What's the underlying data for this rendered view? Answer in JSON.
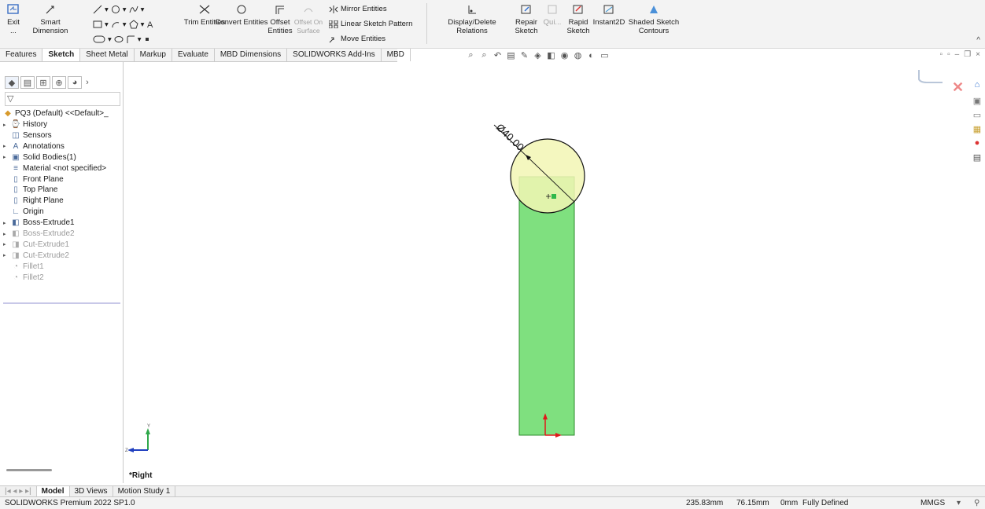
{
  "ribbon": {
    "exit_label": "Exit ...",
    "smart_dimension": "Smart Dimension",
    "trim_entities": "Trim Entities",
    "convert_entities": "Convert Entities",
    "offset_entities": "Offset\nEntities",
    "offset_surface": "Offset On\nSurface",
    "mirror_entities": "Mirror Entities",
    "linear_pattern": "Linear Sketch Pattern",
    "move_entities": "Move Entities",
    "display_relations": "Display/Delete Relations",
    "repair_sketch": "Repair\nSketch",
    "quick_snaps": "Qui...",
    "rapid_sketch": "Rapid\nSketch",
    "instant2d": "Instant2D",
    "shaded_contours": "Shaded Sketch\nContours"
  },
  "tabs": [
    "Features",
    "Sketch",
    "Sheet Metal",
    "Markup",
    "Evaluate",
    "MBD Dimensions",
    "SOLIDWORKS Add-Ins",
    "MBD"
  ],
  "active_tab": "Sketch",
  "tree": {
    "root": "PQ3 (Default) <<Default>_",
    "items": [
      {
        "label": "History",
        "arrow": true,
        "faded": false
      },
      {
        "label": "Sensors",
        "arrow": false,
        "faded": false
      },
      {
        "label": "Annotations",
        "arrow": true,
        "faded": false
      },
      {
        "label": "Solid Bodies(1)",
        "arrow": true,
        "faded": false
      },
      {
        "label": "Material <not specified>",
        "arrow": false,
        "faded": false
      },
      {
        "label": "Front Plane",
        "arrow": false,
        "faded": false
      },
      {
        "label": "Top Plane",
        "arrow": false,
        "faded": false
      },
      {
        "label": "Right Plane",
        "arrow": false,
        "faded": false
      },
      {
        "label": "Origin",
        "arrow": false,
        "faded": false
      },
      {
        "label": "Boss-Extrude1",
        "arrow": true,
        "faded": false
      },
      {
        "label": "Boss-Extrude2",
        "arrow": true,
        "faded": true
      },
      {
        "label": "Cut-Extrude1",
        "arrow": true,
        "faded": true
      },
      {
        "label": "Cut-Extrude2",
        "arrow": true,
        "faded": true
      },
      {
        "label": "Fillet1",
        "arrow": false,
        "faded": true
      },
      {
        "label": "Fillet2",
        "arrow": false,
        "faded": true
      }
    ]
  },
  "viewport": {
    "dimension_label": "Ø40.00",
    "view_name": "*Right",
    "triad_y": "Y",
    "triad_z": "Z"
  },
  "bottom_tabs": [
    "Model",
    "3D Views",
    "Motion Study 1"
  ],
  "status": {
    "product": "SOLIDWORKS Premium 2022 SP1.0",
    "x": "235.83mm",
    "y": "76.15mm",
    "z": "0mm",
    "state": "Fully Defined",
    "units": "MMGS"
  },
  "colors": {
    "body_green": "#7fe07f",
    "circle_fill": "#f2f6b4",
    "accent_blue": "#1f5fbf"
  }
}
